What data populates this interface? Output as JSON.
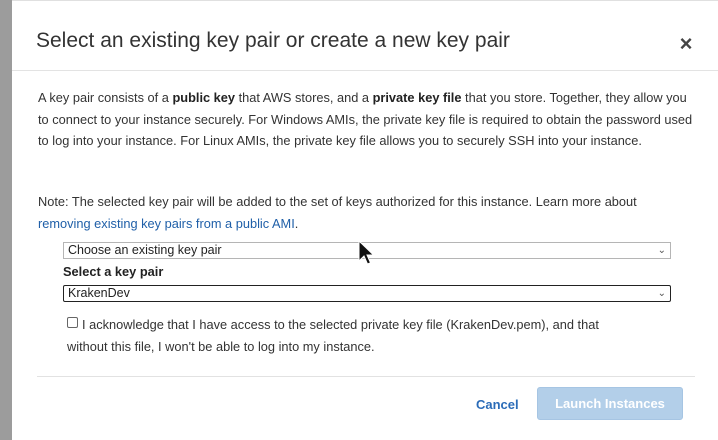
{
  "modal": {
    "title": "Select an existing key pair or create a new key pair",
    "close_glyph": "×"
  },
  "description": {
    "part1": "A key pair consists of a ",
    "bold1": "public key",
    "part2": " that AWS stores, and a ",
    "bold2": "private key file",
    "part3": " that you store. Together, they allow you to connect to your instance securely. For Windows AMIs, the private key file is required to obtain the password used to log into your instance. For Linux AMIs, the private key file allows you to securely SSH into your instance."
  },
  "note": {
    "text": "Note: The selected key pair will be added to the set of keys authorized for this instance. Learn more about ",
    "link": "removing existing key pairs from a public AMI",
    "end": "."
  },
  "key_pair_mode": {
    "selected": "Choose an existing key pair"
  },
  "key_pair": {
    "label": "Select a key pair",
    "selected": "KrakenDev"
  },
  "acknowledge": {
    "line1": "I acknowledge that I have access to the selected private key file (KrakenDev.pem), and that",
    "line2": "without this file, I won't be able to log into my instance.",
    "checked": false
  },
  "footer": {
    "cancel_label": "Cancel",
    "launch_label": "Launch Instances"
  },
  "icons": {
    "close": "close-icon",
    "dropdown": "chevron-down-icon",
    "cursor": "mouse-pointer-icon"
  },
  "colors": {
    "link": "#1f5fa8",
    "launch_disabled": "#b3cfe9"
  }
}
